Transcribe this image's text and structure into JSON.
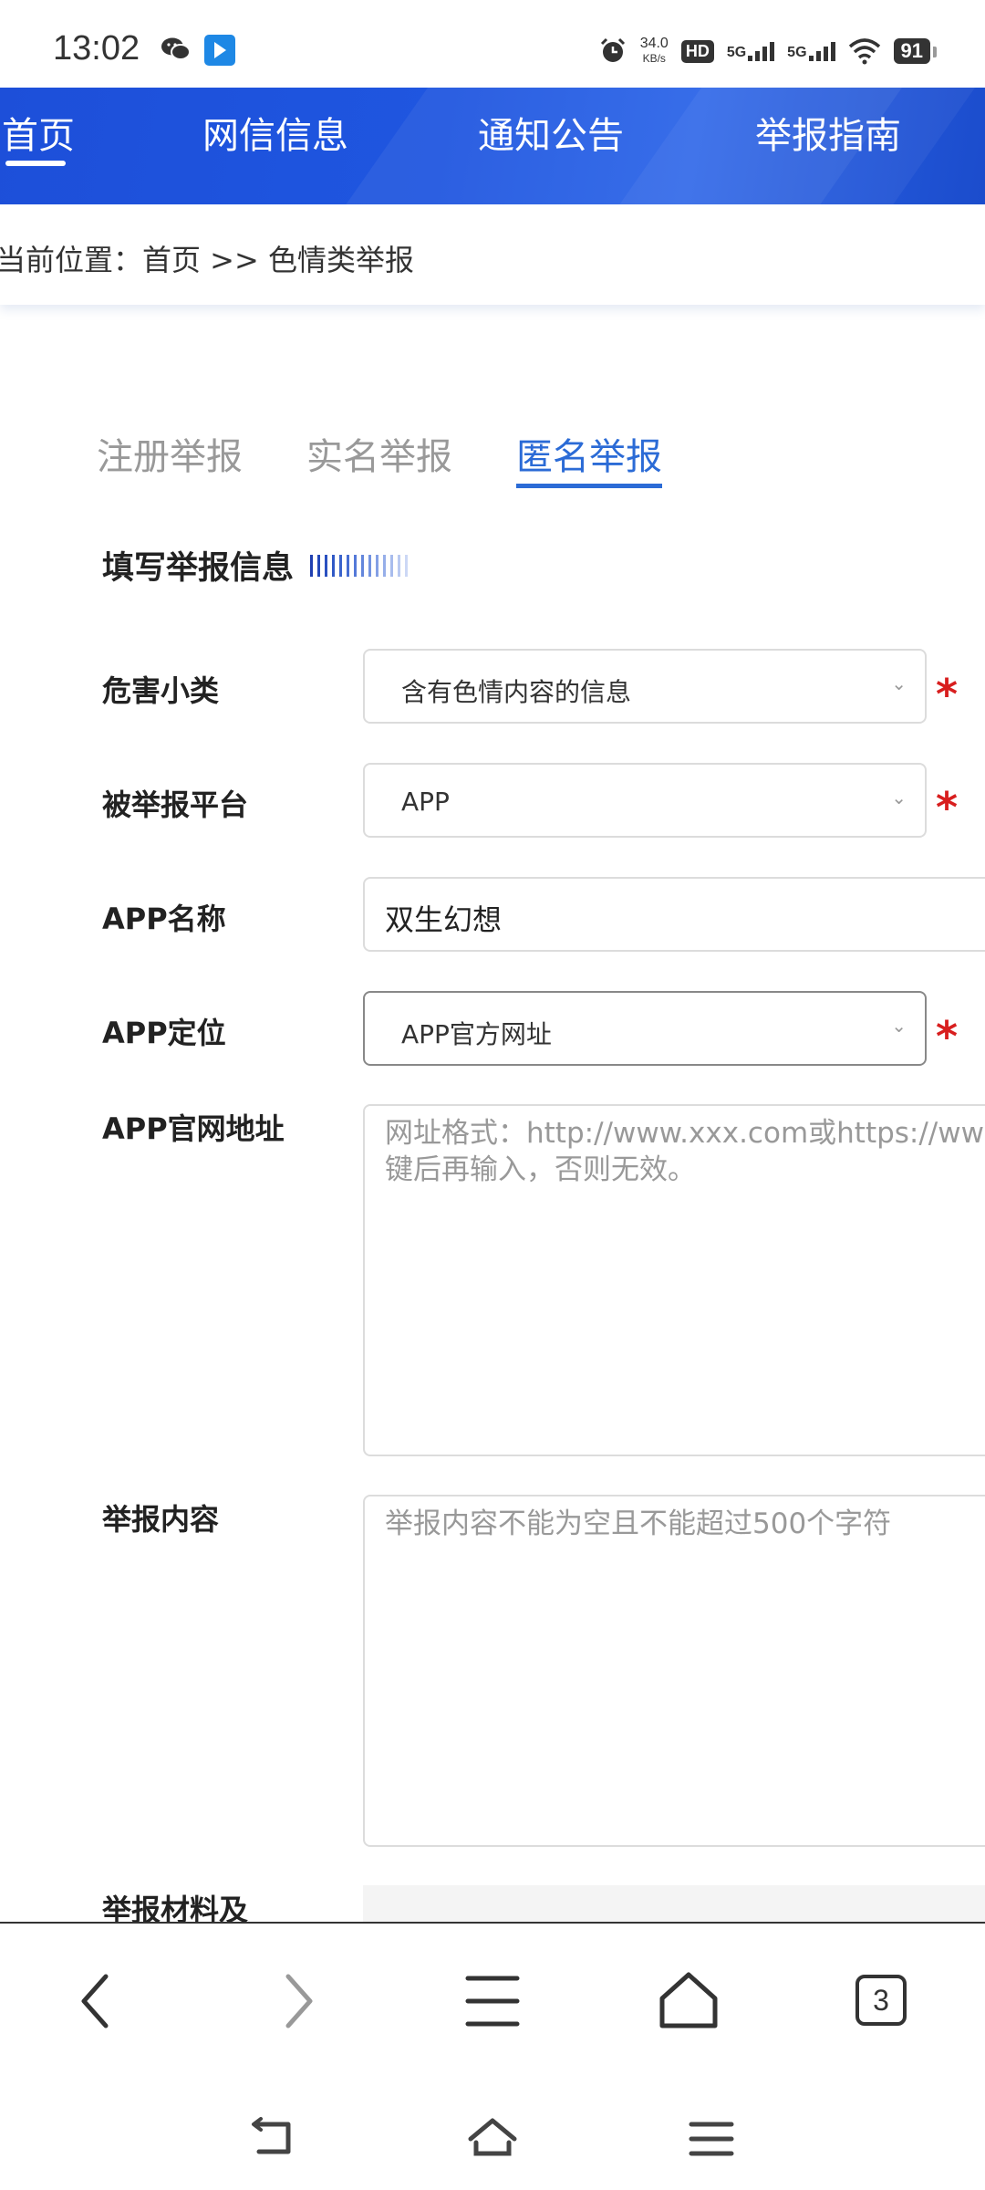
{
  "status_bar": {
    "time": "13:02",
    "net_speed": "34.0",
    "net_speed_unit": "KB/s",
    "hd_label": "HD",
    "sim1_label": "5G",
    "sim2_label": "5G",
    "battery": "91",
    "icons": [
      "wechat-icon",
      "app-notification-icon",
      "alarm-icon",
      "wifi-icon"
    ]
  },
  "nav": {
    "items": [
      "首页",
      "网信信息",
      "通知公告",
      "举报指南"
    ],
    "active_index": 0
  },
  "breadcrumb": "当前位置：首页 >> 色情类举报",
  "tabs": [
    "注册举报",
    "实名举报",
    "匿名举报"
  ],
  "active_tab": 2,
  "section_title": "填写举报信息",
  "form": {
    "harm_category": {
      "label": "危害小类",
      "value": "含有色情内容的信息"
    },
    "platform": {
      "label": "被举报平台",
      "value": "APP"
    },
    "app_name": {
      "label": "APP名称",
      "value": "双生幻想"
    },
    "app_location": {
      "label": "APP定位",
      "value": "APP官方网址"
    },
    "app_url": {
      "label": "APP官网地址",
      "placeholder": "网址格式：http://www.xxx.com或https://ww\n键后再输入，否则无效。"
    },
    "report_content": {
      "label": "举报内容",
      "placeholder": "举报内容不能为空且不能超过500个字符"
    },
    "materials": {
      "label": "举报材料及"
    },
    "required_mark": "*"
  },
  "browser_bar": {
    "tab_count": "3",
    "icons": [
      "back-arrow-icon",
      "forward-arrow-icon",
      "menu-icon",
      "home-icon",
      "tabs-icon"
    ]
  },
  "system_nav": {
    "icons": [
      "return-icon",
      "home-outline-icon",
      "recent-apps-icon"
    ]
  },
  "colors": {
    "nav_blue": "#1d4fd9",
    "accent": "#2B6BD6",
    "required_red": "#d81e1e"
  }
}
